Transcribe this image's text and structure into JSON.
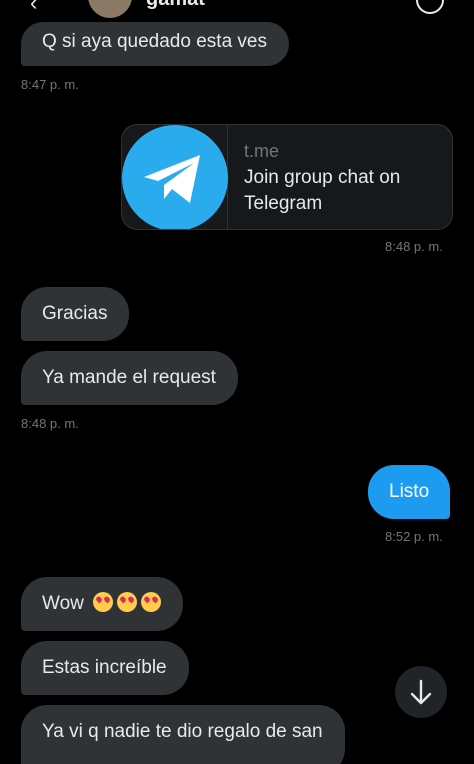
{
  "header": {
    "title": "gamat",
    "back_icon": "arrow-left-icon",
    "info_icon": "info-icon"
  },
  "messages": [
    {
      "text": "Q si aya quedado esta ves",
      "dir": "in"
    },
    {
      "time": "8:47 p. m."
    },
    {
      "card": {
        "domain": "t.me",
        "title": "Join group chat on Telegram",
        "icon": "telegram-logo-icon"
      }
    },
    {
      "time": "8:48 p. m."
    },
    {
      "text": "Gracias",
      "dir": "in"
    },
    {
      "text": "Ya mande el request",
      "dir": "in"
    },
    {
      "time": "8:48 p. m."
    },
    {
      "text": "Listo",
      "dir": "out"
    },
    {
      "time": "8:52 p. m."
    },
    {
      "text": "Wow",
      "dir": "in",
      "emoji": "heart-eyes-face-icon x3"
    },
    {
      "text": "Estas increíble",
      "dir": "in"
    },
    {
      "text": "Ya vi q nadie te dio regalo de san",
      "dir": "in"
    }
  ],
  "scroll_button": {
    "icon": "arrow-down-icon"
  },
  "colors": {
    "background": "#000000",
    "incoming_bubble": "#2f3336",
    "outgoing_bubble": "#1d9bf0",
    "timestamp": "#71767b",
    "telegram_blue": "#2aabee"
  }
}
